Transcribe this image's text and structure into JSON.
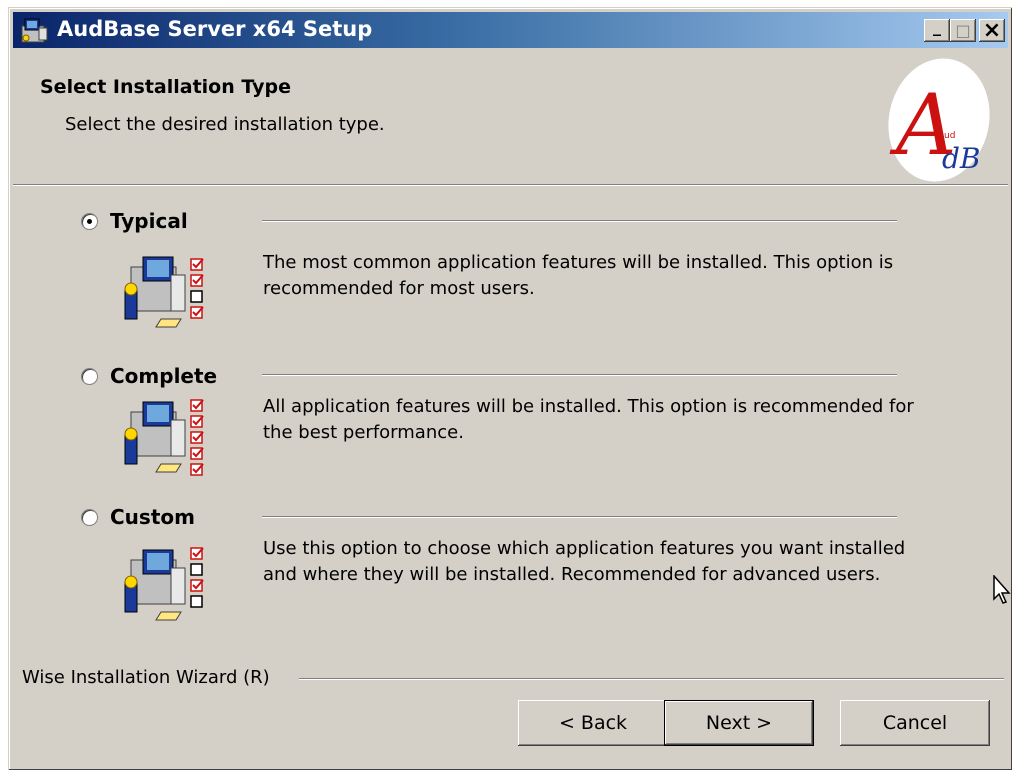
{
  "window": {
    "title": "AudBase Server x64 Setup",
    "controls": {
      "minimize": "_",
      "maximize": "□",
      "close": "×"
    }
  },
  "header": {
    "title": "Select Installation Type",
    "subtitle": "Select the desired installation type.",
    "logo_icon": "audbase-logo"
  },
  "options": [
    {
      "label": "Typical",
      "selected": true,
      "description": "The most common application features will be installed. This option is recommended for most users.",
      "icon": "install-typical-icon"
    },
    {
      "label": "Complete",
      "selected": false,
      "description": "All application features will be installed. This option is recommended for the best performance.",
      "icon": "install-complete-icon"
    },
    {
      "label": "Custom",
      "selected": false,
      "description": "Use this option to choose which application features you want installed and where they will be installed. Recommended for advanced users.",
      "icon": "install-custom-icon"
    }
  ],
  "footer": {
    "wizard_label": "Wise Installation Wizard (R)"
  },
  "buttons": {
    "back": "< Back",
    "next": "Next >",
    "cancel": "Cancel"
  },
  "colors": {
    "dialog_bg": "#d4d0c8",
    "titlebar_start": "#0a246a",
    "titlebar_end": "#a6caf0",
    "logo_red": "#cc1111",
    "logo_blue": "#1a3a9a"
  }
}
